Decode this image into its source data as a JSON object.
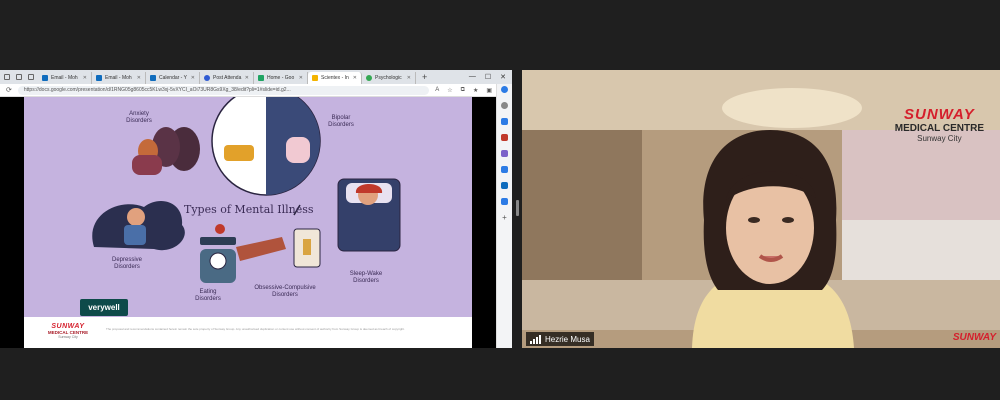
{
  "browser": {
    "tabs": [
      {
        "label": "Email - Moh",
        "color": "#0f6cbd"
      },
      {
        "label": "Email - Moh",
        "color": "#0f6cbd"
      },
      {
        "label": "Calendar - Y",
        "color": "#0f6cbd"
      },
      {
        "label": "Post Attenda",
        "color": "#2f5bd3"
      },
      {
        "label": "Home - Goo",
        "color": "#1fa463"
      },
      {
        "label": "Scientex - In",
        "color": "#f4b400"
      },
      {
        "label": "Psychologic",
        "color": "#34a853"
      }
    ],
    "new_tab": "+",
    "url": "https://docs.google.com/presentation/d/1RNG05g8605cc5KLw3xj-5vXYCI_aOi73UR8Gs9Xg_38/edit?pli=1#slide=id.g2..."
  },
  "slide": {
    "title": "Types of Mental Illness",
    "labels": {
      "anxiety": "Anxiety\nDisorders",
      "bipolar": "Bipolar\nDisorders",
      "depressive": "Depressive\nDisorders",
      "eating": "Eating\nDisorders",
      "ocd": "Obsessive-Compulsive\nDisorders",
      "sleep": "Sleep-Wake\nDisorders"
    },
    "badge": "verywell",
    "footer": {
      "brand": "SUNWAY",
      "subbrand": "MEDICAL CENTRE",
      "city": "Sunway City",
      "disclaimer": "The proposal and recommendations contained herein remain the sole property of Sunway Group. Any unauthorised duplication or content use without consent of authority from Sunway Group is deemed as breach of copyright."
    }
  },
  "camera": {
    "brand": "SUNWAY",
    "subbrand": "MEDICAL CENTRE",
    "city": "Sunway City",
    "bottom_brand": "SUNWAY",
    "participant_name": "Hezrie Musa"
  }
}
